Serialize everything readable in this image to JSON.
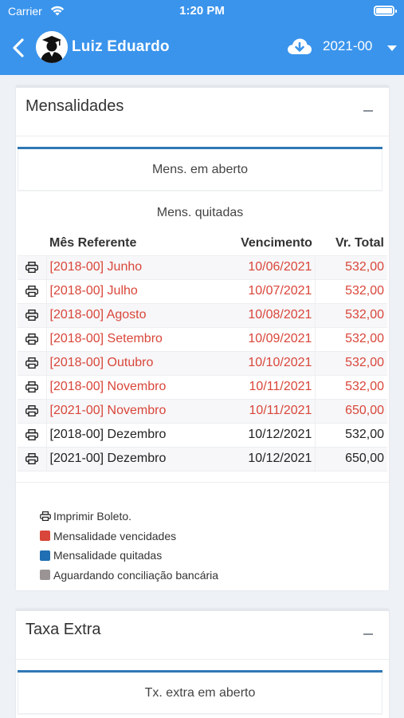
{
  "status_bar": {
    "carrier": "Carrier",
    "time": "1:20 PM"
  },
  "header": {
    "user_name": "Luiz Eduardo",
    "year": "2021-00"
  },
  "mensalidades": {
    "title": "Mensalidades",
    "open_label": "Mens. em aberto",
    "paid_label": "Mens. quitadas",
    "columns": [
      "Mês Referente",
      "Vencimento",
      "Vr. Total"
    ],
    "rows": [
      {
        "mes": "[2018-00] Junho",
        "vencimento": "10/06/2021",
        "total": "532,00",
        "status": "vencida"
      },
      {
        "mes": "[2018-00] Julho",
        "vencimento": "10/07/2021",
        "total": "532,00",
        "status": "vencida"
      },
      {
        "mes": "[2018-00] Agosto",
        "vencimento": "10/08/2021",
        "total": "532,00",
        "status": "vencida"
      },
      {
        "mes": "[2018-00] Setembro",
        "vencimento": "10/09/2021",
        "total": "532,00",
        "status": "vencida"
      },
      {
        "mes": "[2018-00] Outubro",
        "vencimento": "10/10/2021",
        "total": "532,00",
        "status": "vencida"
      },
      {
        "mes": "[2018-00] Novembro",
        "vencimento": "10/11/2021",
        "total": "532,00",
        "status": "vencida"
      },
      {
        "mes": "[2021-00] Novembro",
        "vencimento": "10/11/2021",
        "total": "650,00",
        "status": "vencida"
      },
      {
        "mes": "[2018-00] Dezembro",
        "vencimento": "10/12/2021",
        "total": "532,00",
        "status": "aberta"
      },
      {
        "mes": "[2021-00] Dezembro",
        "vencimento": "10/12/2021",
        "total": "650,00",
        "status": "aberta"
      }
    ],
    "legend": {
      "print": "Imprimir Boleto.",
      "overdue": "Mensalidade vencidades",
      "paid": "Mensalidade quitadas",
      "pending": "Aguardando conciliação bancária"
    }
  },
  "taxa_extra": {
    "title": "Taxa Extra",
    "open_label": "Tx. extra em aberto"
  },
  "colors": {
    "header_blue": "#3a94ec",
    "overdue_red": "#d9463a",
    "paid_blue": "#1f6fb2",
    "pending_gray": "#9b9494",
    "accent_bar": "#2f78b4"
  },
  "icons": {
    "back": "chevron-left-icon",
    "avatar": "graduate-avatar-icon",
    "cloud": "cloud-download-icon",
    "print": "printer-icon"
  }
}
